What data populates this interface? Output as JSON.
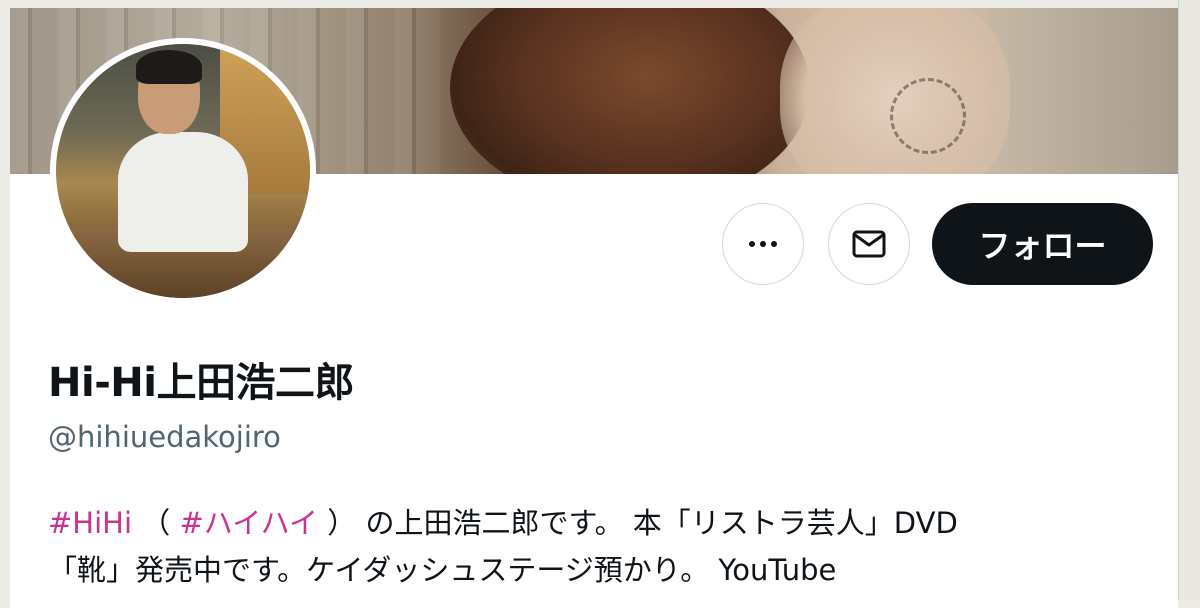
{
  "profile": {
    "display_name": "Hi-Hi上田浩二郎",
    "handle": "@hihiuedakojiro",
    "follow_label": "フォロー"
  },
  "bio": {
    "tag1": "#HiHi",
    "paren_open": " （ ",
    "tag2": "#ハイハイ",
    "line1_rest": " ） の上田浩二郎です。 本「リストラ芸人」DVD",
    "line2": "「靴」発売中です。ケイダッシュステージ預かり。 YouTube"
  },
  "colors": {
    "hashtag": "#c9348f",
    "follow_button_bg": "#0f1419",
    "handle_text": "#536471"
  },
  "icons": {
    "more": "more-horizontal-icon",
    "message": "envelope-icon"
  }
}
